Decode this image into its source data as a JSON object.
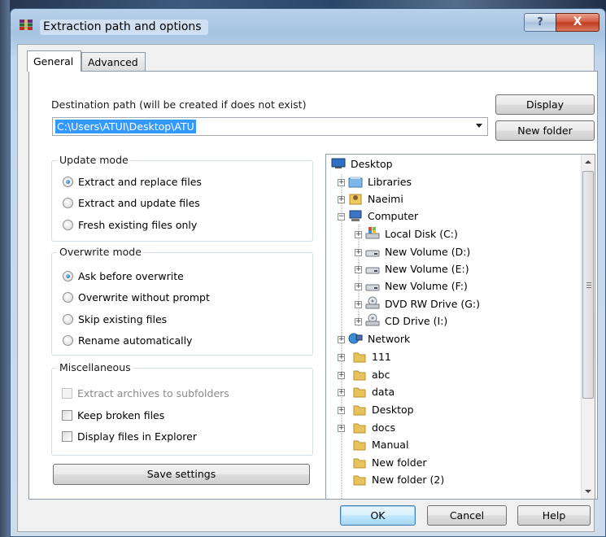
{
  "window": {
    "title": "Extraction path and options",
    "help_glyph": "?",
    "close_glyph": "X"
  },
  "tabs": [
    {
      "label": "General",
      "active": true
    },
    {
      "label": "Advanced",
      "active": false
    }
  ],
  "destination": {
    "label": "Destination path (will be created if does not exist)",
    "value": "C:\\Users\\ATUI\\Desktop\\ATU"
  },
  "buttons": {
    "display": "Display",
    "new_folder": "New folder",
    "save_settings": "Save settings",
    "ok": "OK",
    "cancel": "Cancel",
    "help": "Help"
  },
  "update_mode": {
    "title": "Update mode",
    "options": [
      {
        "label": "Extract and replace files",
        "selected": true
      },
      {
        "label": "Extract and update files",
        "selected": false
      },
      {
        "label": "Fresh existing files only",
        "selected": false
      }
    ]
  },
  "overwrite_mode": {
    "title": "Overwrite mode",
    "options": [
      {
        "label": "Ask before overwrite",
        "selected": true
      },
      {
        "label": "Overwrite without prompt",
        "selected": false
      },
      {
        "label": "Skip existing files",
        "selected": false
      },
      {
        "label": "Rename automatically",
        "selected": false
      }
    ]
  },
  "miscellaneous": {
    "title": "Miscellaneous",
    "options": [
      {
        "label": "Extract archives to subfolders",
        "checked": false,
        "disabled": true
      },
      {
        "label": "Keep broken files",
        "checked": false,
        "disabled": false
      },
      {
        "label": "Display files in Explorer",
        "checked": false,
        "disabled": false
      }
    ]
  },
  "tree": {
    "items": [
      {
        "label": "Desktop",
        "icon": "desktop-icon"
      },
      {
        "label": "Libraries",
        "icon": "library-icon"
      },
      {
        "label": "Naeimi",
        "icon": "user-folder-icon"
      },
      {
        "label": "Computer",
        "icon": "computer-icon"
      },
      {
        "label": "Local Disk (C:)",
        "icon": "system-drive-icon"
      },
      {
        "label": "New Volume (D:)",
        "icon": "drive-icon"
      },
      {
        "label": "New Volume (E:)",
        "icon": "drive-icon"
      },
      {
        "label": "New Volume (F:)",
        "icon": "drive-icon"
      },
      {
        "label": "DVD RW Drive (G:)",
        "icon": "optical-drive-icon"
      },
      {
        "label": "CD Drive (I:)",
        "icon": "optical-drive-icon"
      },
      {
        "label": "Network",
        "icon": "network-icon"
      },
      {
        "label": "111",
        "icon": "folder-icon"
      },
      {
        "label": "abc",
        "icon": "folder-icon"
      },
      {
        "label": "data",
        "icon": "folder-icon"
      },
      {
        "label": "Desktop",
        "icon": "folder-icon"
      },
      {
        "label": "docs",
        "icon": "folder-icon"
      },
      {
        "label": "Manual",
        "icon": "folder-icon"
      },
      {
        "label": "New folder",
        "icon": "folder-icon"
      },
      {
        "label": "New folder (2)",
        "icon": "folder-icon"
      }
    ]
  },
  "colors": {
    "selection": "#3399ff",
    "close_button": "#c2381c",
    "folder": "#e8c25a"
  }
}
